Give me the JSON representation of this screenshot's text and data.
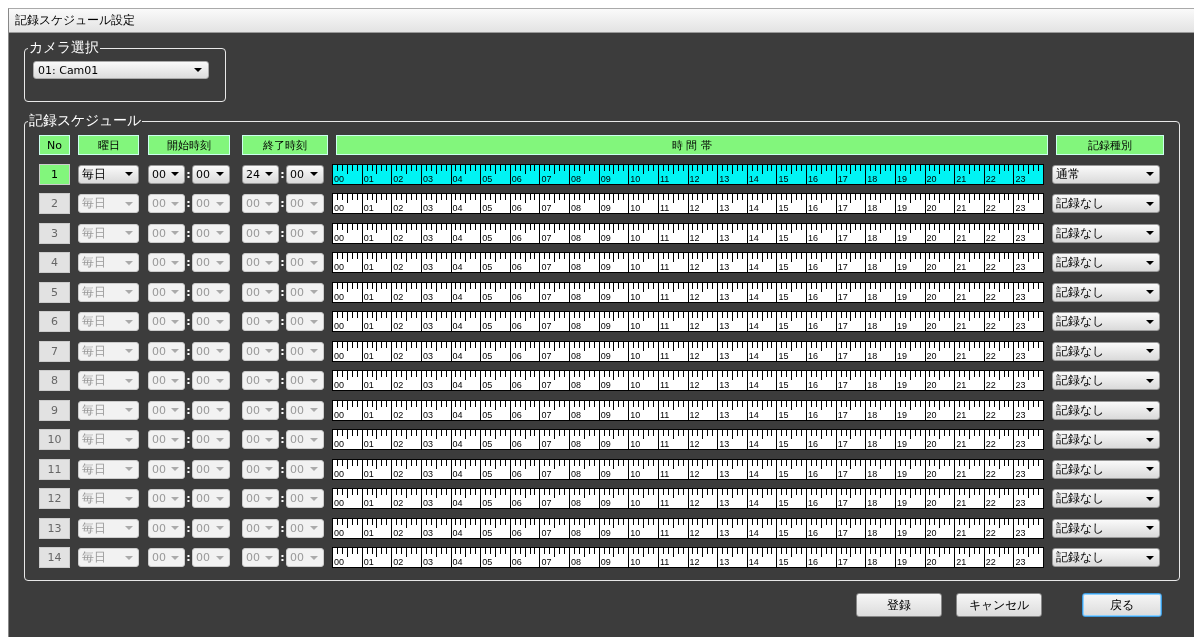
{
  "window": {
    "title": "記録スケジュール設定"
  },
  "camera_group": {
    "title": "カメラ選択",
    "camera": "01: Cam01"
  },
  "schedule_group": {
    "title": "記録スケジュール",
    "columns": [
      "No",
      "曜日",
      "開始時刻",
      "終了時刻",
      "時 間 帯",
      "記録種別"
    ],
    "rows": [
      {
        "no": "1",
        "disabled": false,
        "day": "毎日",
        "start": {
          "hour": "00",
          "separator": ":",
          "minute": "00"
        },
        "end": {
          "hour": "24",
          "separator": ":",
          "minute": "00"
        },
        "recording": true,
        "ruler_labels": [
          "00",
          "01",
          "02",
          "03",
          "04",
          "05",
          "06",
          "07",
          "08",
          "09",
          "10",
          "11",
          "12",
          "13",
          "14",
          "15",
          "16",
          "17",
          "18",
          "19",
          "20",
          "21",
          "22",
          "23"
        ],
        "type": "通常"
      },
      {
        "no": "2",
        "disabled": true,
        "day": "毎日",
        "start": {
          "hour": "00",
          "separator": ":",
          "minute": "00"
        },
        "end": {
          "hour": "00",
          "separator": ":",
          "minute": "00"
        },
        "recording": false,
        "ruler_labels": [
          "00",
          "01",
          "02",
          "03",
          "04",
          "05",
          "06",
          "07",
          "08",
          "09",
          "10",
          "11",
          "12",
          "13",
          "14",
          "15",
          "16",
          "17",
          "18",
          "19",
          "20",
          "21",
          "22",
          "23"
        ],
        "type": "記録なし"
      },
      {
        "no": "3",
        "disabled": true,
        "day": "毎日",
        "start": {
          "hour": "00",
          "separator": ":",
          "minute": "00"
        },
        "end": {
          "hour": "00",
          "separator": ":",
          "minute": "00"
        },
        "recording": false,
        "ruler_labels": [
          "00",
          "01",
          "02",
          "03",
          "04",
          "05",
          "06",
          "07",
          "08",
          "09",
          "10",
          "11",
          "12",
          "13",
          "14",
          "15",
          "16",
          "17",
          "18",
          "19",
          "20",
          "21",
          "22",
          "23"
        ],
        "type": "記録なし"
      },
      {
        "no": "4",
        "disabled": true,
        "day": "毎日",
        "start": {
          "hour": "00",
          "separator": ":",
          "minute": "00"
        },
        "end": {
          "hour": "00",
          "separator": ":",
          "minute": "00"
        },
        "recording": false,
        "ruler_labels": [
          "00",
          "01",
          "02",
          "03",
          "04",
          "05",
          "06",
          "07",
          "08",
          "09",
          "10",
          "11",
          "12",
          "13",
          "14",
          "15",
          "16",
          "17",
          "18",
          "19",
          "20",
          "21",
          "22",
          "23"
        ],
        "type": "記録なし"
      },
      {
        "no": "5",
        "disabled": true,
        "day": "毎日",
        "start": {
          "hour": "00",
          "separator": ":",
          "minute": "00"
        },
        "end": {
          "hour": "00",
          "separator": ":",
          "minute": "00"
        },
        "recording": false,
        "ruler_labels": [
          "00",
          "01",
          "02",
          "03",
          "04",
          "05",
          "06",
          "07",
          "08",
          "09",
          "10",
          "11",
          "12",
          "13",
          "14",
          "15",
          "16",
          "17",
          "18",
          "19",
          "20",
          "21",
          "22",
          "23"
        ],
        "type": "記録なし"
      },
      {
        "no": "6",
        "disabled": true,
        "day": "毎日",
        "start": {
          "hour": "00",
          "separator": ":",
          "minute": "00"
        },
        "end": {
          "hour": "00",
          "separator": ":",
          "minute": "00"
        },
        "recording": false,
        "ruler_labels": [
          "00",
          "01",
          "02",
          "03",
          "04",
          "05",
          "06",
          "07",
          "08",
          "09",
          "10",
          "11",
          "12",
          "13",
          "14",
          "15",
          "16",
          "17",
          "18",
          "19",
          "20",
          "21",
          "22",
          "23"
        ],
        "type": "記録なし"
      },
      {
        "no": "7",
        "disabled": true,
        "day": "毎日",
        "start": {
          "hour": "00",
          "separator": ":",
          "minute": "00"
        },
        "end": {
          "hour": "00",
          "separator": ":",
          "minute": "00"
        },
        "recording": false,
        "ruler_labels": [
          "00",
          "01",
          "02",
          "03",
          "04",
          "05",
          "06",
          "07",
          "08",
          "09",
          "10",
          "11",
          "12",
          "13",
          "14",
          "15",
          "16",
          "17",
          "18",
          "19",
          "20",
          "21",
          "22",
          "23"
        ],
        "type": "記録なし"
      },
      {
        "no": "8",
        "disabled": true,
        "day": "毎日",
        "start": {
          "hour": "00",
          "separator": ":",
          "minute": "00"
        },
        "end": {
          "hour": "00",
          "separator": ":",
          "minute": "00"
        },
        "recording": false,
        "ruler_labels": [
          "00",
          "01",
          "02",
          "03",
          "04",
          "05",
          "06",
          "07",
          "08",
          "09",
          "10",
          "11",
          "12",
          "13",
          "14",
          "15",
          "16",
          "17",
          "18",
          "19",
          "20",
          "21",
          "22",
          "23"
        ],
        "type": "記録なし"
      },
      {
        "no": "9",
        "disabled": true,
        "day": "毎日",
        "start": {
          "hour": "00",
          "separator": ":",
          "minute": "00"
        },
        "end": {
          "hour": "00",
          "separator": ":",
          "minute": "00"
        },
        "recording": false,
        "ruler_labels": [
          "00",
          "01",
          "02",
          "03",
          "04",
          "05",
          "06",
          "07",
          "08",
          "09",
          "10",
          "11",
          "12",
          "13",
          "14",
          "15",
          "16",
          "17",
          "18",
          "19",
          "20",
          "21",
          "22",
          "23"
        ],
        "type": "記録なし"
      },
      {
        "no": "10",
        "disabled": true,
        "day": "毎日",
        "start": {
          "hour": "00",
          "separator": ":",
          "minute": "00"
        },
        "end": {
          "hour": "00",
          "separator": ":",
          "minute": "00"
        },
        "recording": false,
        "ruler_labels": [
          "00",
          "01",
          "02",
          "03",
          "04",
          "05",
          "06",
          "07",
          "08",
          "09",
          "10",
          "11",
          "12",
          "13",
          "14",
          "15",
          "16",
          "17",
          "18",
          "19",
          "20",
          "21",
          "22",
          "23"
        ],
        "type": "記録なし"
      },
      {
        "no": "11",
        "disabled": true,
        "day": "毎日",
        "start": {
          "hour": "00",
          "separator": ":",
          "minute": "00"
        },
        "end": {
          "hour": "00",
          "separator": ":",
          "minute": "00"
        },
        "recording": false,
        "ruler_labels": [
          "00",
          "01",
          "02",
          "03",
          "04",
          "05",
          "06",
          "07",
          "08",
          "09",
          "10",
          "11",
          "12",
          "13",
          "14",
          "15",
          "16",
          "17",
          "18",
          "19",
          "20",
          "21",
          "22",
          "23"
        ],
        "type": "記録なし"
      },
      {
        "no": "12",
        "disabled": true,
        "day": "毎日",
        "start": {
          "hour": "00",
          "separator": ":",
          "minute": "00"
        },
        "end": {
          "hour": "00",
          "separator": ":",
          "minute": "00"
        },
        "recording": false,
        "ruler_labels": [
          "00",
          "01",
          "02",
          "03",
          "04",
          "05",
          "06",
          "07",
          "08",
          "09",
          "10",
          "11",
          "12",
          "13",
          "14",
          "15",
          "16",
          "17",
          "18",
          "19",
          "20",
          "21",
          "22",
          "23"
        ],
        "type": "記録なし"
      },
      {
        "no": "13",
        "disabled": true,
        "day": "毎日",
        "start": {
          "hour": "00",
          "separator": ":",
          "minute": "00"
        },
        "end": {
          "hour": "00",
          "separator": ":",
          "minute": "00"
        },
        "recording": false,
        "ruler_labels": [
          "00",
          "01",
          "02",
          "03",
          "04",
          "05",
          "06",
          "07",
          "08",
          "09",
          "10",
          "11",
          "12",
          "13",
          "14",
          "15",
          "16",
          "17",
          "18",
          "19",
          "20",
          "21",
          "22",
          "23"
        ],
        "type": "記録なし"
      },
      {
        "no": "14",
        "disabled": true,
        "day": "毎日",
        "start": {
          "hour": "00",
          "separator": ":",
          "minute": "00"
        },
        "end": {
          "hour": "00",
          "separator": ":",
          "minute": "00"
        },
        "recording": false,
        "ruler_labels": [
          "00",
          "01",
          "02",
          "03",
          "04",
          "05",
          "06",
          "07",
          "08",
          "09",
          "10",
          "11",
          "12",
          "13",
          "14",
          "15",
          "16",
          "17",
          "18",
          "19",
          "20",
          "21",
          "22",
          "23"
        ],
        "type": "記録なし"
      }
    ]
  },
  "buttons": [
    {
      "label": "登録",
      "focused": false
    },
    {
      "label": "キャンセル",
      "focused": false
    },
    {
      "label": "戻る",
      "focused": true
    }
  ]
}
